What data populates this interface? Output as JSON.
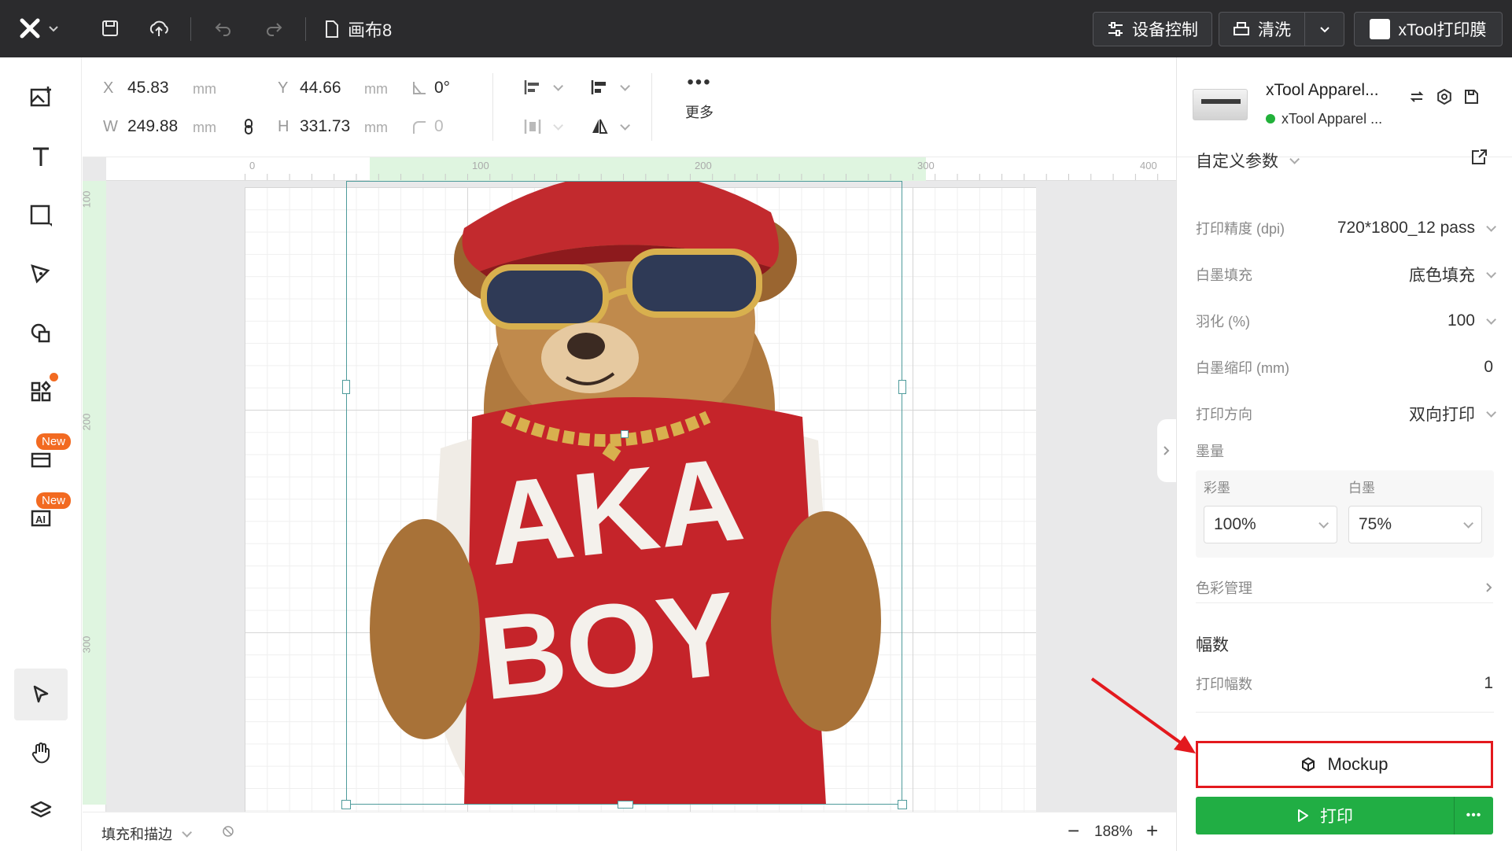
{
  "topbar": {
    "doc_title": "画布8",
    "device_control": "设备控制",
    "clean": "清洗",
    "machine": "xTool打印膜"
  },
  "left_toolbar": {
    "new_badge": "New"
  },
  "props": {
    "x_label": "X",
    "x_value": "45.83",
    "x_unit": "mm",
    "y_label": "Y",
    "y_value": "44.66",
    "y_unit": "mm",
    "rotate_value": "0°",
    "w_label": "W",
    "w_value": "249.88",
    "w_unit": "mm",
    "h_label": "H",
    "h_value": "331.73",
    "h_unit": "mm",
    "radius_value": "0",
    "more_label": "更多"
  },
  "rulers": {
    "h_ticks": [
      "0",
      "100",
      "200",
      "300",
      "400"
    ],
    "v_ticks": [
      "100",
      "200",
      "300"
    ]
  },
  "artwork": {
    "text_line1": "AKA",
    "text_line2": "BOY"
  },
  "statusbar": {
    "fill_stroke": "填充和描边",
    "zoom": "188%"
  },
  "device": {
    "name": "xTool Apparel...",
    "status": "xTool Apparel ..."
  },
  "settings": {
    "section_title": "自定义参数",
    "dpi_label": "打印精度 (dpi)",
    "dpi_value": "720*1800_12 pass",
    "white_fill_label": "白墨填充",
    "white_fill_value": "底色填充",
    "feather_label": "羽化 (%)",
    "feather_value": "100",
    "white_shrink_label": "白墨缩印 (mm)",
    "white_shrink_value": "0",
    "direction_label": "打印方向",
    "direction_value": "双向打印",
    "ink_label": "墨量",
    "color_ink_label": "彩墨",
    "color_ink_value": "100%",
    "white_ink_label": "白墨",
    "white_ink_value": "75%",
    "color_mgmt_label": "色彩管理",
    "copies_title": "幅数",
    "copies_label": "打印幅数",
    "copies_value": "1"
  },
  "actions": {
    "mockup_label": "Mockup",
    "print_label": "打印"
  },
  "colors": {
    "topbar": "#2b2b2d",
    "print_green": "#21ae44",
    "annotation_red": "#e3191e",
    "selection": "#4e9b9b",
    "badge_orange": "#f26a21"
  }
}
